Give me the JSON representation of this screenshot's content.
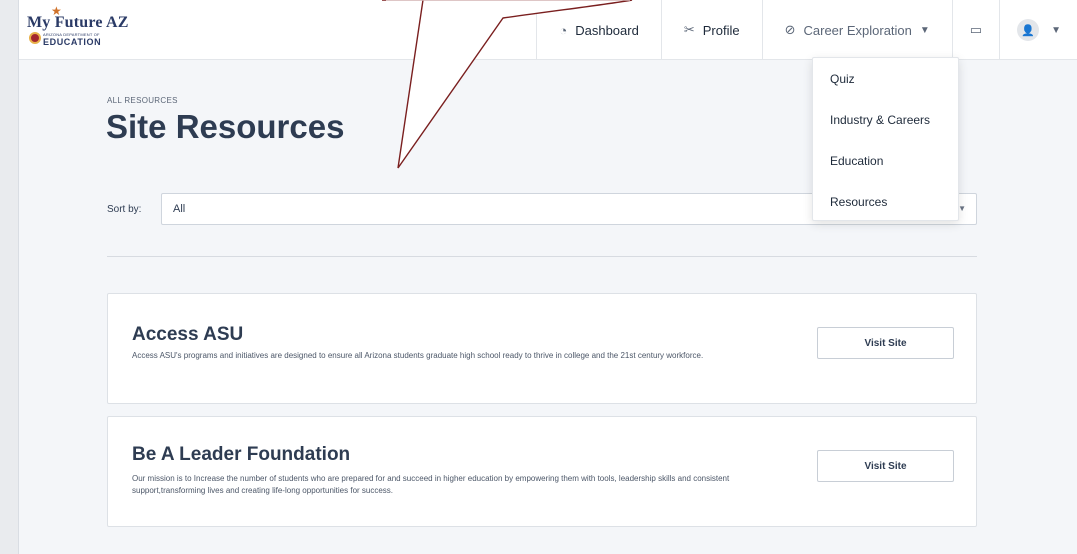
{
  "header": {
    "brand": "My Future AZ",
    "dept": "ARIZONA DEPARTMENT OF",
    "edu": "EDUCATION",
    "nav": {
      "dashboard": "Dashboard",
      "profile": "Profile",
      "career": "Career Exploration"
    }
  },
  "dropdown": {
    "items": [
      "Quiz",
      "Industry & Careers",
      "Education",
      "Resources"
    ]
  },
  "page": {
    "eyebrow": "ALL RESOURCES",
    "title": "Site Resources",
    "sort_label": "Sort by:",
    "sort_value": "All"
  },
  "resources": [
    {
      "title": "Access ASU",
      "description": "Access ASU's programs and initiatives are designed to ensure all Arizona students graduate high school ready to thrive in college and the 21st century workforce.",
      "button": "Visit Site"
    },
    {
      "title": "Be A Leader Foundation",
      "description": "Our mission is to Increase the number of students who are prepared for and succeed in higher education by empowering them with tools, leadership skills and consistent support,transforming lives and creating life-long opportunities for success.",
      "button": "Visit Site"
    }
  ],
  "icons": {
    "dashboard": "dashboard-icon",
    "profile": "tools-icon",
    "career": "compass-icon",
    "inbox": "inbox-icon",
    "avatar": "avatar-icon"
  },
  "colors": {
    "background": "#f4f6f9",
    "heading": "#2e3c52",
    "brand": "#2a3a66",
    "accent": "#d0722a"
  }
}
